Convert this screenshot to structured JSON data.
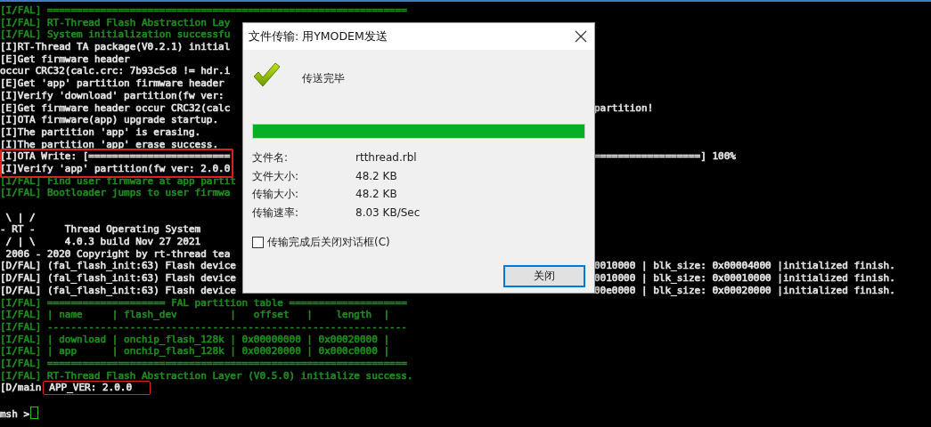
{
  "terminal": {
    "lines": [
      {
        "kind": "log",
        "text": "[I/FAL] =============================================================",
        "color": "#1e8c1e",
        "highlighted": false
      },
      {
        "kind": "log",
        "text": "[I/FAL] RT-Thread Flash Abstraction Lay",
        "color": "#1e8c1e",
        "highlighted": false
      },
      {
        "kind": "log",
        "text": "[I/FAL] System initialization successfu",
        "color": "#1e8c1e",
        "highlighted": false
      },
      {
        "kind": "log",
        "text": "[I]RT-Thread TA package(V0.2.1) initial",
        "color": "#e6e6e6",
        "highlighted": false
      },
      {
        "kind": "log",
        "text": "[E]Get firmware header",
        "color": "#e6e6e6",
        "highlighted": false
      },
      {
        "kind": "log",
        "text": "occur CRC32(calc.crc: 7b93c5c8 != hdr.i",
        "color": "#e6e6e6",
        "highlighted": false
      },
      {
        "kind": "log",
        "text": "[E]Get 'app' partition firmware header",
        "color": "#e6e6e6",
        "highlighted": false
      },
      {
        "kind": "log",
        "text": "[I]Verify 'download' partition(fw ver:",
        "color": "#e6e6e6",
        "highlighted": false
      },
      {
        "kind": "log",
        "text": "[E]Get firmware header occur CRC32(calc",
        "right": "partition!",
        "color": "#e6e6e6",
        "highlighted": false
      },
      {
        "kind": "log",
        "text": "[I]OTA firmware(app) upgrade startup.",
        "color": "#e6e6e6",
        "highlighted": false
      },
      {
        "kind": "log",
        "text": "[I]The partition 'app' is erasing.",
        "color": "#e6e6e6",
        "highlighted": false
      },
      {
        "kind": "log",
        "text": "[I]The partition 'app' erase success.",
        "color": "#e6e6e6",
        "highlighted": false
      },
      {
        "kind": "log",
        "text": "[I]OTA Write: [========================",
        "right": "==================] 100%",
        "color": "#e6e6e6",
        "highlighted": true
      },
      {
        "kind": "log",
        "text": "[I]Verify 'app' partition(fw ver: 2.0.0",
        "color": "#e6e6e6",
        "highlighted": true
      },
      {
        "kind": "log",
        "text": "[I/FAL] Find user firmware at app partit",
        "color": "#1e8c1e",
        "highlighted": false
      },
      {
        "kind": "log",
        "text": "[I/FAL] Bootloader jumps to user firmwa",
        "color": "#1e8c1e",
        "highlighted": false
      },
      {
        "kind": "blank",
        "highlighted": false
      },
      {
        "kind": "log",
        "text": " \\ | /",
        "color": "#e6e6e6",
        "highlighted": false
      },
      {
        "kind": "log",
        "text": "- RT -     Thread Operating System",
        "color": "#e6e6e6",
        "highlighted": false
      },
      {
        "kind": "log",
        "text": " / | \\     4.0.3 build Nov 27 2021",
        "color": "#e6e6e6",
        "highlighted": false
      },
      {
        "kind": "log",
        "text": " 2006 - 2020 Copyright by rt-thread tea",
        "color": "#e6e6e6",
        "highlighted": false
      },
      {
        "kind": "log",
        "text": "[D/FAL] (fal_flash_init:63) Flash device",
        "right": "0010000 | blk_size: 0x00004000 |initialized finish.",
        "color": "#e6e6e6",
        "highlighted": false
      },
      {
        "kind": "log",
        "text": "[D/FAL] (fal_flash_init:63) Flash device",
        "right": "0010000 | blk_size: 0x00010000 |initialized finish.",
        "color": "#e6e6e6",
        "highlighted": false
      },
      {
        "kind": "log",
        "text": "[D/FAL] (fal_flash_init:63) Flash device",
        "right": "00e0000 | blk_size: 0x00020000 |initialized finish.",
        "color": "#e6e6e6",
        "highlighted": false
      },
      {
        "kind": "log",
        "text": "[I/FAL] ==================== FAL partition table ====================",
        "color": "#1e8c1e",
        "highlighted": false
      },
      {
        "kind": "log",
        "text": "[I/FAL] | name     | flash_dev         |   offset   |    length  |",
        "color": "#1e8c1e",
        "highlighted": false
      },
      {
        "kind": "log",
        "text": "[I/FAL] -------------------------------------------------------------",
        "color": "#1e8c1e",
        "highlighted": false
      },
      {
        "kind": "log",
        "text": "[I/FAL] | download | onchip_flash_128k | 0x00000000 | 0x00020000 |",
        "color": "#1e8c1e",
        "highlighted": false
      },
      {
        "kind": "log",
        "text": "[I/FAL] | app      | onchip_flash_128k | 0x00020000 | 0x000c0000 |",
        "color": "#1e8c1e",
        "highlighted": false
      },
      {
        "kind": "log",
        "text": "[I/FAL] =============================================================",
        "color": "#1e8c1e",
        "highlighted": false
      },
      {
        "kind": "log",
        "text": "[I/FAL] RT-Thread Flash Abstraction Layer (V0.5.0) initialize success.",
        "color": "#1e8c1e",
        "highlighted": false
      },
      {
        "kind": "log",
        "text": "[D/main",
        "boxed_text": "APP_VER: 2.0.0",
        "color": "#e6e6e6",
        "highlighted": false
      },
      {
        "kind": "blank",
        "highlighted": false
      },
      {
        "kind": "prompt",
        "text": "msh >",
        "color": "#e6e6e6",
        "highlighted": false
      }
    ]
  },
  "dialog": {
    "title": "文件传输: 用YMODEM发送",
    "status": "传送完毕",
    "progress": {
      "level": 1
    },
    "info": [
      {
        "label": "文件名:",
        "value": "rtthread.rbl"
      },
      {
        "label": "文件大小:",
        "value": "48.2 KB"
      },
      {
        "label": "传输大小:",
        "value": "48.2 KB"
      },
      {
        "label": "传输速率:",
        "value": "8.03 KB/Sec"
      }
    ],
    "close_option": {
      "label": "传输完成后关闭对话框(C)",
      "checked": false
    },
    "buttons": [
      {
        "label": "关闭",
        "default": true
      }
    ]
  }
}
